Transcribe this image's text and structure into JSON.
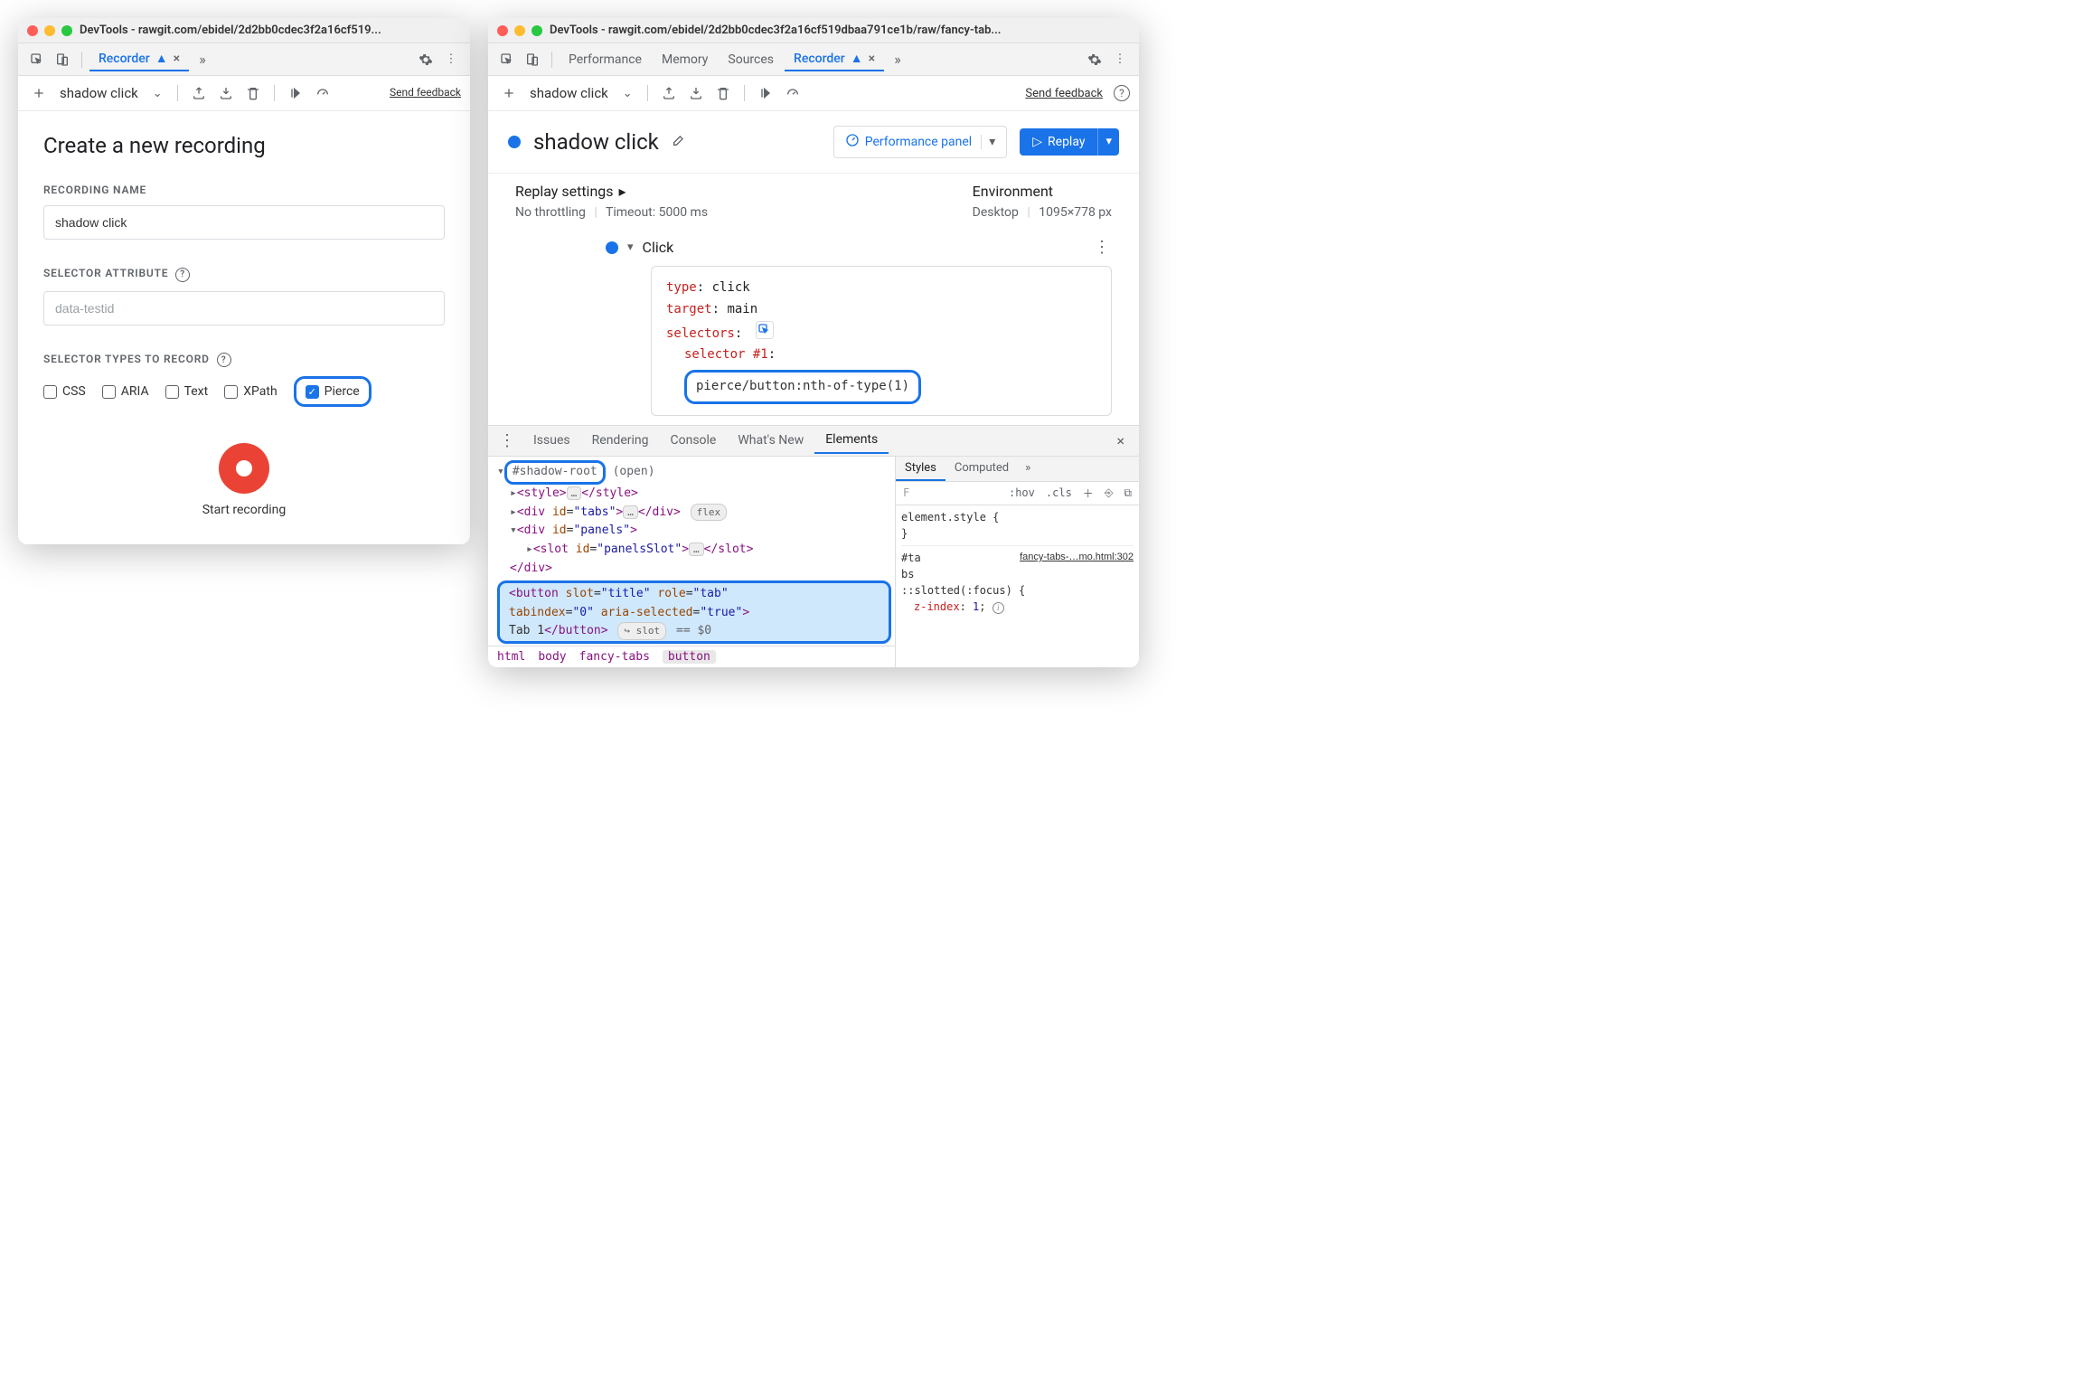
{
  "left": {
    "title": "DevTools - rawgit.com/ebidel/2d2bb0cdec3f2a16cf519...",
    "tabs": {
      "recorder": "Recorder"
    },
    "toolbar": {
      "flow_name": "shadow click",
      "send_feedback": "Send feedback"
    },
    "page": {
      "heading": "Create a new recording",
      "name_label": "RECORDING NAME",
      "name_value": "shadow click",
      "attr_label": "SELECTOR ATTRIBUTE",
      "attr_placeholder": "data-testid",
      "types_label": "SELECTOR TYPES TO RECORD",
      "types": {
        "css": "CSS",
        "aria": "ARIA",
        "text": "Text",
        "xpath": "XPath",
        "pierce": "Pierce"
      },
      "start": "Start recording"
    }
  },
  "right": {
    "title": "DevTools - rawgit.com/ebidel/2d2bb0cdec3f2a16cf519dbaa791ce1b/raw/fancy-tab...",
    "tabs": {
      "performance": "Performance",
      "memory": "Memory",
      "sources": "Sources",
      "recorder": "Recorder"
    },
    "toolbar": {
      "flow_name": "shadow click",
      "send_feedback": "Send feedback"
    },
    "header": {
      "title": "shadow click",
      "perf_panel": "Performance panel",
      "replay": "Replay"
    },
    "settings": {
      "replay_title": "Replay settings",
      "throttling": "No throttling",
      "timeout": "Timeout: 5000 ms",
      "env_title": "Environment",
      "env_device": "Desktop",
      "env_size": "1095×778 px"
    },
    "step": {
      "name": "Click",
      "type_k": "type",
      "type_v": "click",
      "target_k": "target",
      "target_v": "main",
      "selectors_k": "selectors",
      "sel1_k": "selector #1",
      "sel1_v": "pierce/button:nth-of-type(1)"
    },
    "drawer": {
      "tabs": {
        "issues": "Issues",
        "rendering": "Rendering",
        "console": "Console",
        "whatsnew": "What's New",
        "elements": "Elements"
      },
      "tree": {
        "shadow_root": "#shadow-root",
        "shadow_open": "(open)",
        "style_open": "<style>",
        "style_close": "</style>",
        "tabs_open": "<div id=\"tabs\">",
        "tabs_close": "</div>",
        "flex_badge": "flex",
        "panels_open": "<div id=\"panels\">",
        "slot_open": "<slot id=\"panelsSlot\">",
        "slot_close": "</slot>",
        "div_close": "</div>",
        "button_l1": "<button slot=\"title\" role=\"tab\"",
        "button_l2": "tabindex=\"0\" aria-selected=\"true\">",
        "button_text": "Tab 1",
        "button_close": "</button>",
        "slot_badge": "slot",
        "eq0": "== $0"
      },
      "crumbs": {
        "html": "html",
        "body": "body",
        "ft": "fancy-tabs",
        "button": "button"
      },
      "styles": {
        "tabs": {
          "styles": "Styles",
          "computed": "Computed"
        },
        "filter_placeholder": "F",
        "hov": ":hov",
        "cls": ".cls",
        "el_style": "element.style {",
        "close_brace": "}",
        "rule_sel": "#ta bs",
        "file_link": "fancy-tabs-…mo.html:302",
        "slotted": "::slotted(:focus) {",
        "zindex_k": "z-index",
        "zindex_v": "1"
      }
    }
  }
}
